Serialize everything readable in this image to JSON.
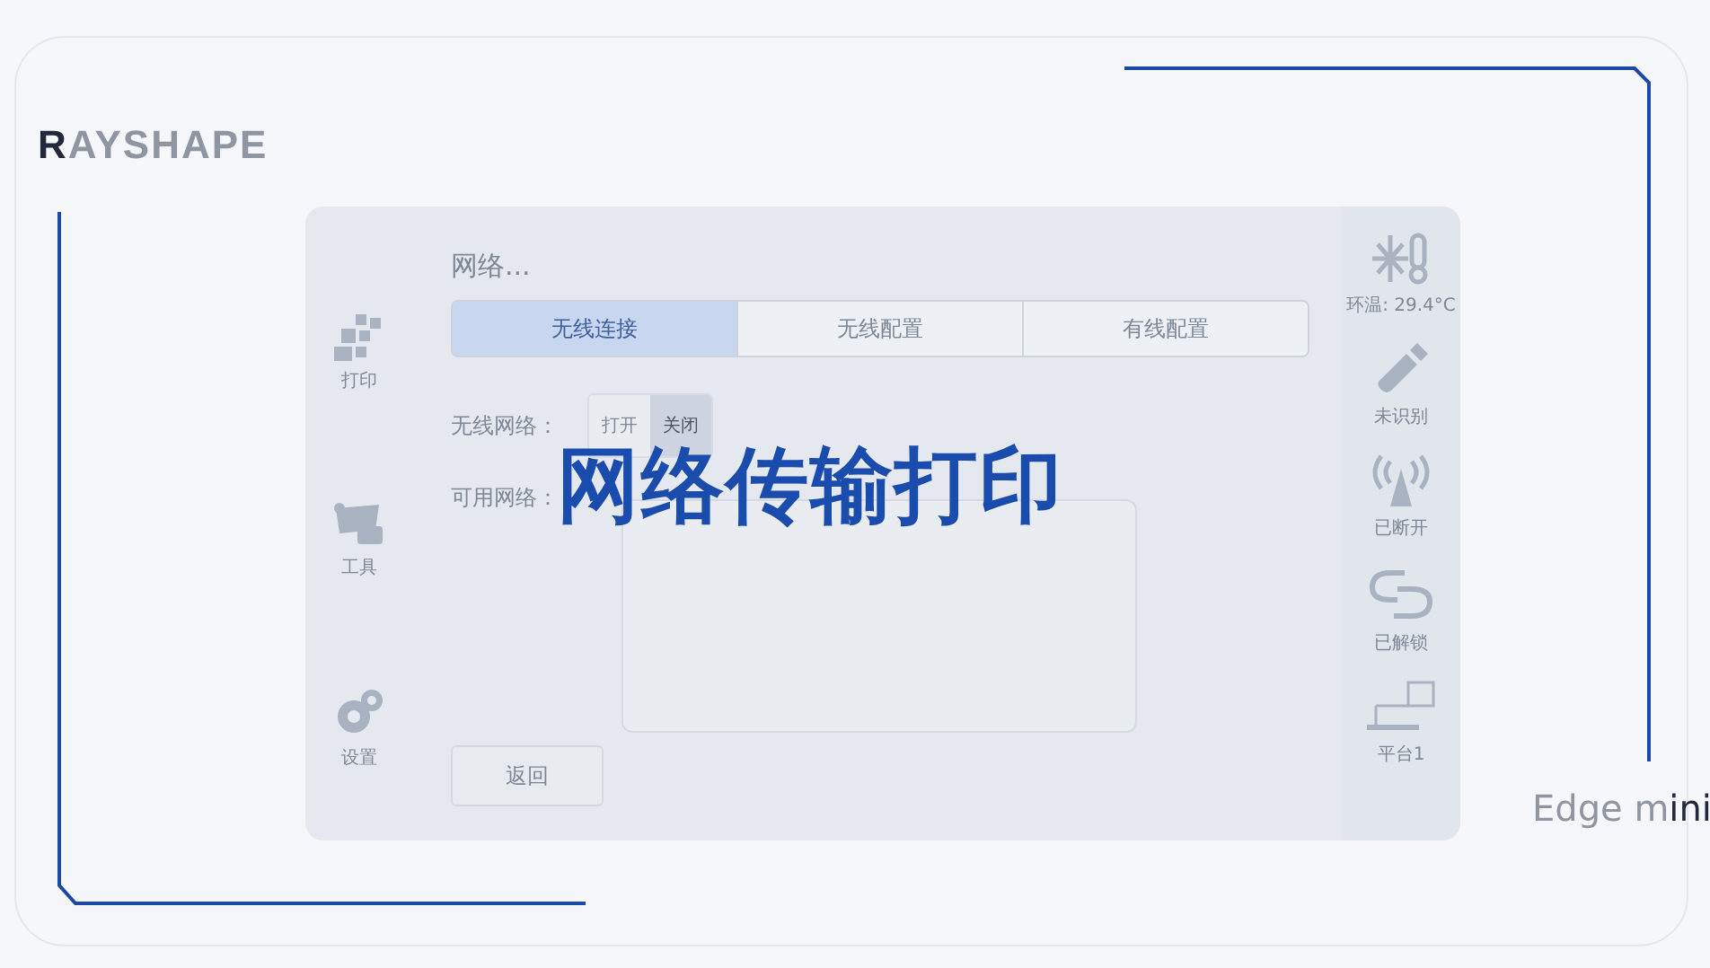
{
  "logo": {
    "lead": "R",
    "rest": "AYSHAPE"
  },
  "overlay_title": "网络传输打印",
  "product": {
    "lead": "Edge m",
    "rest": "ini"
  },
  "left_nav": [
    {
      "label": "打印"
    },
    {
      "label": "工具"
    },
    {
      "label": "设置"
    }
  ],
  "screen": {
    "title": "网络...",
    "tabs": [
      {
        "label": "无线连接",
        "selected": true
      },
      {
        "label": "无线配置",
        "selected": false
      },
      {
        "label": "有线配置",
        "selected": false
      }
    ],
    "wifi_label": "无线网络：",
    "wifi_toggle": [
      {
        "label": "打开",
        "selected": false
      },
      {
        "label": "关闭",
        "selected": true
      }
    ],
    "networks_label": "可用网络：",
    "back_button": "返回"
  },
  "status": [
    {
      "label": "环温: 29.4°C"
    },
    {
      "label": "未识别"
    },
    {
      "label": "已断开"
    },
    {
      "label": "已解锁"
    },
    {
      "label": "平台1"
    }
  ]
}
